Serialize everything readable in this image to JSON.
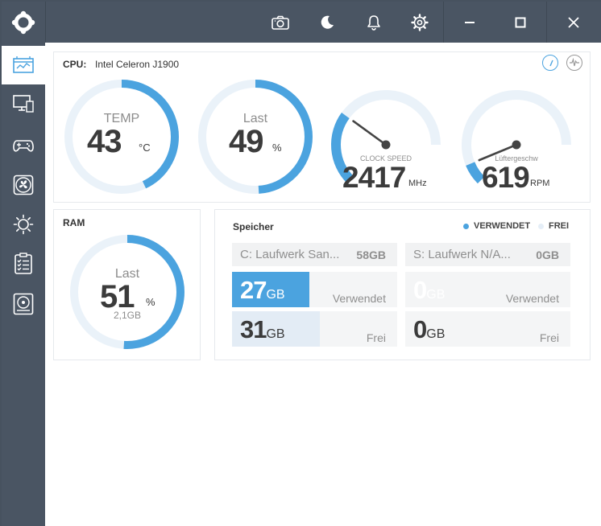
{
  "window": {
    "accent": "#4ba3df",
    "chrome": "#4a5563"
  },
  "titlebar": {
    "icons": [
      "app-logo-icon",
      "camera-icon",
      "moon-icon",
      "bell-icon",
      "gear-icon",
      "minimize-icon",
      "maximize-icon",
      "close-icon"
    ]
  },
  "sidebar": {
    "items": [
      {
        "icon": "dashboard-icon",
        "active": true
      },
      {
        "icon": "monitor-icon",
        "active": false
      },
      {
        "icon": "gamepad-icon",
        "active": false
      },
      {
        "icon": "fan-icon",
        "active": false
      },
      {
        "icon": "brightness-icon",
        "active": false
      },
      {
        "icon": "checklist-icon",
        "active": false
      },
      {
        "icon": "storage-icon",
        "active": false
      }
    ]
  },
  "cpu": {
    "title": "CPU:",
    "model": "Intel Celeron J1900",
    "temp": {
      "label": "TEMP",
      "value": "43",
      "unit": "°C",
      "fraction": 0.43
    },
    "load": {
      "label": "Last",
      "value": "49",
      "unit": "%",
      "fraction": 0.49
    },
    "clock": {
      "label": "CLOCK SPEED",
      "value": "2417",
      "unit": "MHz",
      "fraction": 0.36
    },
    "fan": {
      "label": "Lüftergeschw",
      "value": "619",
      "unit": "RPM",
      "fraction": 0.1
    }
  },
  "ram": {
    "title": "RAM",
    "label": "Last",
    "value": "51",
    "unit": "%",
    "used": "2,1GB",
    "fraction": 0.51
  },
  "storage": {
    "title": "Speicher",
    "legend_used": "VERWENDET",
    "legend_free": "FREI",
    "drives": [
      {
        "name": "C: Laufwerk San...",
        "size": "58GB",
        "used": "27",
        "used_unit": "GB",
        "used_label": "Verwendet",
        "free": "31",
        "free_unit": "GB",
        "free_label": "Frei",
        "used_fraction": 0.47,
        "free_fraction": 0.53
      },
      {
        "name": "S: Laufwerk N/A...",
        "size": "0GB",
        "used": "0",
        "used_unit": "GB",
        "used_label": "Verwendet",
        "free": "0",
        "free_unit": "GB",
        "free_label": "Frei",
        "used_fraction": 0,
        "free_fraction": 0
      }
    ]
  }
}
